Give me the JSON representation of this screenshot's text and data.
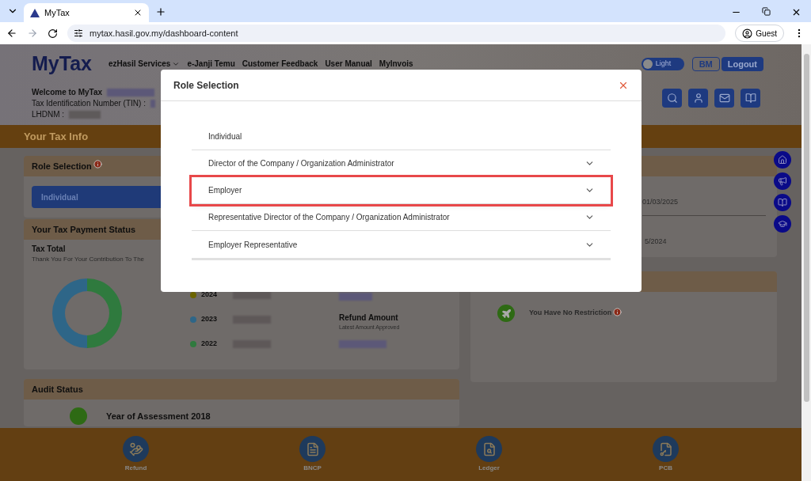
{
  "browser": {
    "tab_title": "MyTax",
    "url": "mytax.hasil.gov.my/dashboard-content",
    "profile": "Guest"
  },
  "header": {
    "logo": "MyTax",
    "nav": [
      {
        "label": "ezHasil Services",
        "dropdown": true
      },
      {
        "label": "e-Janji Temu",
        "dropdown": false
      },
      {
        "label": "Customer Feedback",
        "dropdown": false
      },
      {
        "label": "User Manual",
        "dropdown": false
      },
      {
        "label": "MyInvois",
        "dropdown": false
      }
    ],
    "theme_toggle": {
      "label": "Light",
      "on": false
    },
    "buttons": [
      "BM",
      "Logout"
    ],
    "welcome": "Welcome to MyTax",
    "tin_label": "Tax Identification Number (TIN) :",
    "lhdnm_label": "LHDNM :"
  },
  "section_title": "Your Tax Info",
  "role_card": {
    "title": "Role Selection",
    "role": "Individual"
  },
  "payment_card": {
    "title": "Your Tax Payment Status",
    "tax_total": "Tax Total",
    "subtitle": "Thank You For Your Contribution To The",
    "legend": [
      {
        "year": "2024",
        "color": "#6b6400"
      },
      {
        "year": "2023",
        "color": "#2e6688"
      },
      {
        "year": "2022",
        "color": "#2f7a3e"
      }
    ],
    "refund_title": "Refund Amount",
    "refund_subtitle": "Latest Amount Approved"
  },
  "right_card": {
    "dates": [
      "01/03/2025",
      "5/2024"
    ],
    "restriction": "You Have No Restriction"
  },
  "audit_card": {
    "title": "Audit Status",
    "year": "Year of Assessment 2018"
  },
  "bottom_nav": [
    "Refund",
    "BNCP",
    "Ledger",
    "PCB"
  ],
  "modal": {
    "title": "Role Selection",
    "roles": [
      {
        "label": "Individual",
        "expandable": false,
        "highlighted": false
      },
      {
        "label": "Director of the Company / Organization Administrator",
        "expandable": true,
        "highlighted": false
      },
      {
        "label": "Employer",
        "expandable": true,
        "highlighted": true
      },
      {
        "label": "Representative Director of the Company / Organization Administrator",
        "expandable": true,
        "highlighted": false
      },
      {
        "label": "Employer Representative",
        "expandable": true,
        "highlighted": false
      }
    ]
  }
}
